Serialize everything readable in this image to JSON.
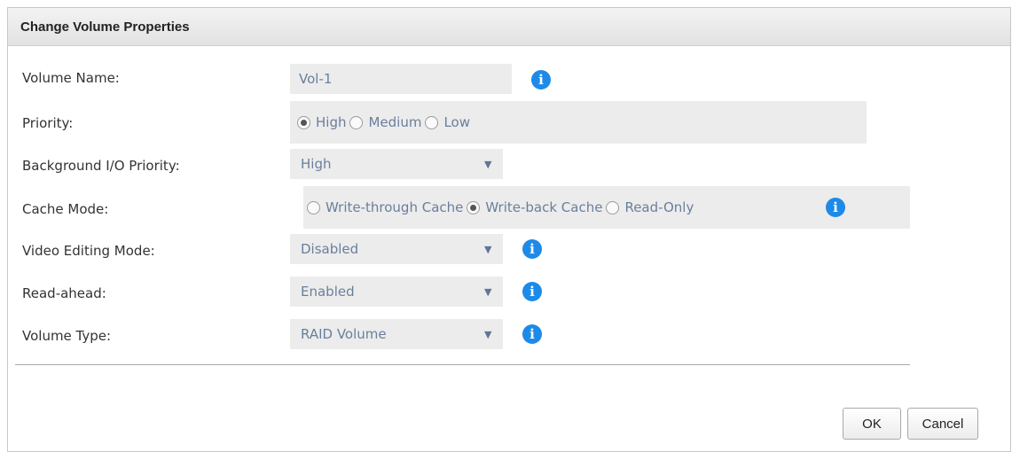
{
  "dialog": {
    "title": "Change Volume Properties"
  },
  "fields": {
    "volume_name": {
      "label": "Volume Name:",
      "value": "Vol-1"
    },
    "priority": {
      "label": "Priority:",
      "options": [
        "High",
        "Medium",
        "Low"
      ],
      "selected": "High"
    },
    "background_io_priority": {
      "label": "Background I/O Priority:",
      "value": "High"
    },
    "cache_mode": {
      "label": "Cache Mode:",
      "options": [
        "Write-through Cache",
        "Write-back Cache",
        "Read-Only"
      ],
      "selected": "Write-back Cache"
    },
    "video_editing_mode": {
      "label": "Video Editing Mode:",
      "value": "Disabled"
    },
    "read_ahead": {
      "label": "Read-ahead:",
      "value": "Enabled"
    },
    "volume_type": {
      "label": "Volume Type:",
      "value": "RAID Volume"
    }
  },
  "icons": {
    "info": "info-icon",
    "dropdown": "chevron-down-icon"
  },
  "info_glyph": "i",
  "dropdown_glyph": "▼",
  "buttons": {
    "ok": "OK",
    "cancel": "Cancel"
  },
  "colors": {
    "info_icon": "#1e8ae8",
    "field_background": "#ececec",
    "field_text": "#6a7f9c",
    "title_bar": "#e8e8e8"
  }
}
